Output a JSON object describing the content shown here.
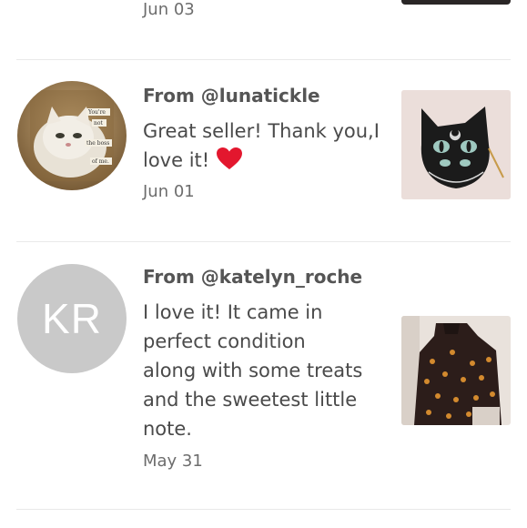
{
  "reviews": [
    {
      "date": "Jun 03"
    },
    {
      "from": "From @lunatickle",
      "comment": "Great seller! Thank you,I love it!",
      "emoji": "heart-icon",
      "date": "Jun 01",
      "avatar_text": [
        "You're",
        "not",
        "the boss",
        "of me."
      ]
    },
    {
      "from": "From @katelyn_roche",
      "initials": "KR",
      "comment_lines": [
        "I love it! It came in",
        "perfect condition",
        "along with some treats",
        "and the sweetest little",
        "note."
      ],
      "date": "May 31"
    }
  ],
  "colors": {
    "divider": "#e9e9e9",
    "avatar_placeholder": "#c9c9c9",
    "heart": "#e3172e"
  }
}
